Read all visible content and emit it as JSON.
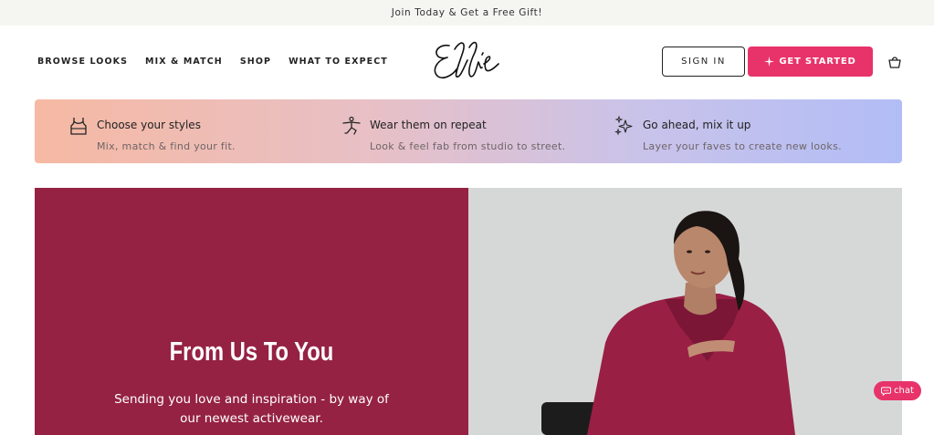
{
  "announcement": {
    "text": "Join Today & Get a Free Gift!"
  },
  "nav": {
    "items": [
      {
        "label": "BROWSE LOOKS"
      },
      {
        "label": "MIX & MATCH"
      },
      {
        "label": "SHOP"
      },
      {
        "label": "WHAT TO EXPECT"
      }
    ]
  },
  "logo": {
    "text": "Ellie"
  },
  "header": {
    "sign_in_label": "SIGN IN",
    "get_started_label": "GET STARTED",
    "cart_icon": "shopping-bag-icon"
  },
  "steps": [
    {
      "icon": "tank-top-icon",
      "title": "Choose your styles",
      "description": "Mix, match & find your fit."
    },
    {
      "icon": "yoga-pose-icon",
      "title": "Wear them on repeat",
      "description": "Look & feel fab from studio to street."
    },
    {
      "icon": "sparkles-icon",
      "title": "Go ahead, mix it up",
      "description": "Layer your faves to create new looks."
    }
  ],
  "hero": {
    "title": "From Us To You",
    "subtitle_line1": "Sending you love and inspiration - by way of",
    "subtitle_line2": "our newest activewear."
  },
  "chat": {
    "label": "chat"
  },
  "colors": {
    "brand_pink": "#e8336a",
    "hero_maroon": "#952243",
    "banner_gradient_start": "#f6b9a3",
    "banner_gradient_end": "#b2bdf6"
  }
}
